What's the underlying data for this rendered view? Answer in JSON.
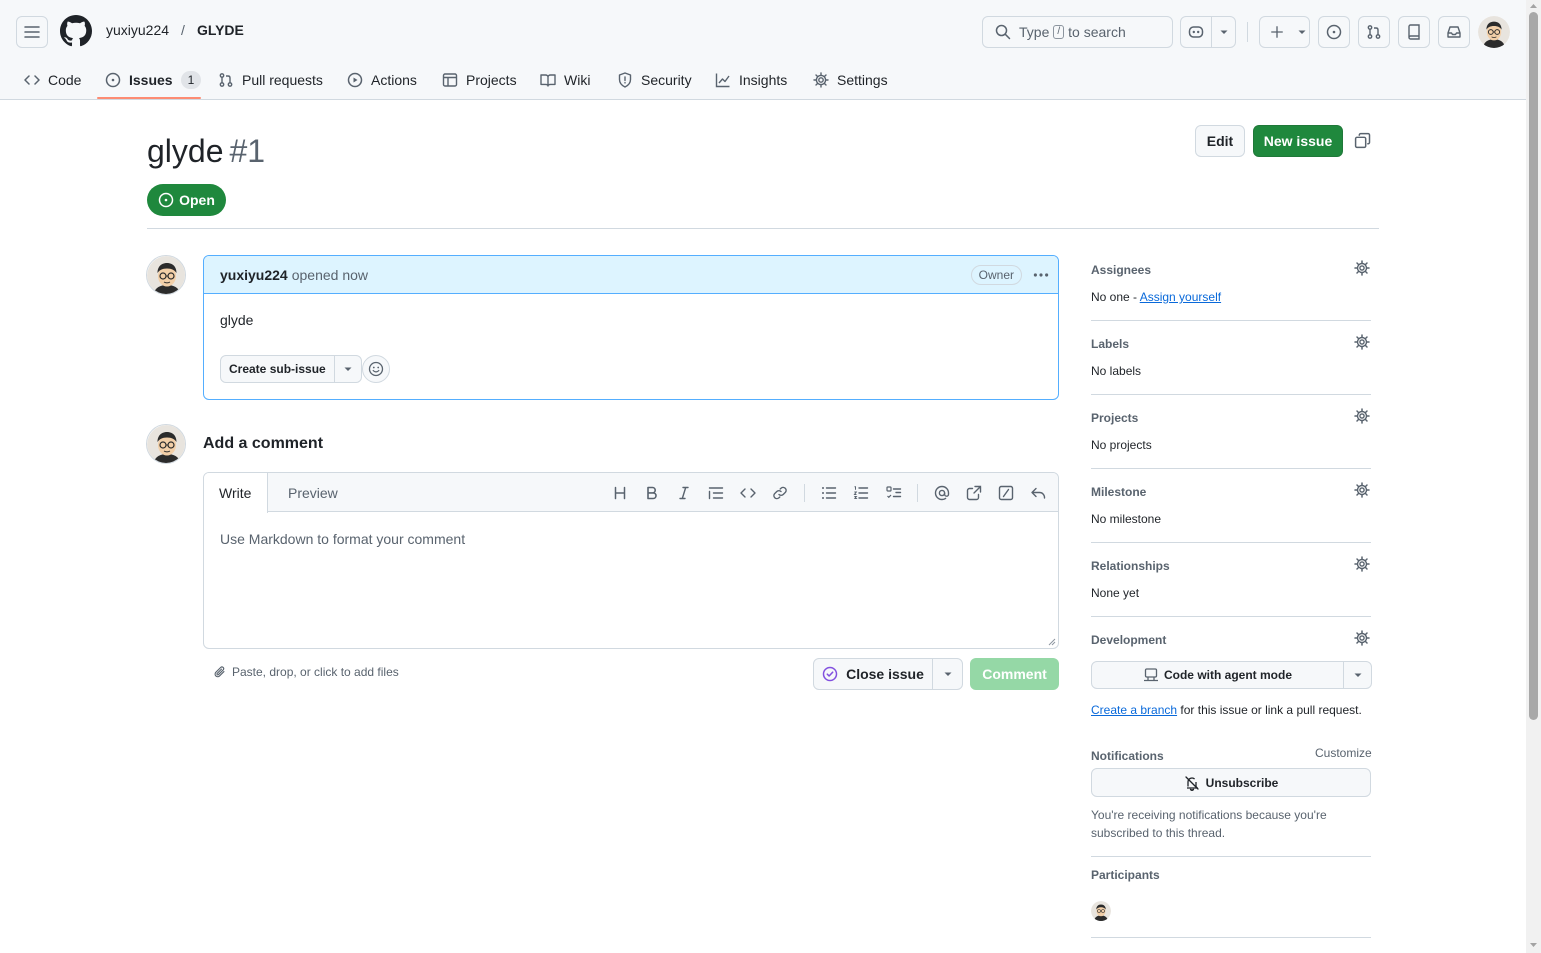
{
  "header": {
    "owner": "yuxiyu224",
    "separator": "/",
    "repo": "GLYDE",
    "search": {
      "prefix": "Type",
      "key": "/",
      "suffix": "to search"
    }
  },
  "nav_tabs": [
    {
      "label": "Code",
      "icon": "code-icon"
    },
    {
      "label": "Issues",
      "icon": "issue-opened-icon",
      "counter": "1",
      "selected": true
    },
    {
      "label": "Pull requests",
      "icon": "git-pull-request-icon"
    },
    {
      "label": "Actions",
      "icon": "play-icon"
    },
    {
      "label": "Projects",
      "icon": "table-icon"
    },
    {
      "label": "Wiki",
      "icon": "book-icon"
    },
    {
      "label": "Security",
      "icon": "shield-icon"
    },
    {
      "label": "Insights",
      "icon": "graph-icon"
    },
    {
      "label": "Settings",
      "icon": "gear-icon"
    }
  ],
  "issue": {
    "title": "glyde",
    "number": "#1",
    "state": "Open",
    "edit_label": "Edit",
    "new_issue_label": "New issue"
  },
  "comment": {
    "author": "yuxiyu224",
    "action": "opened now",
    "role_badge": "Owner",
    "body": "glyde",
    "create_sub_issue_label": "Create sub-issue"
  },
  "composer": {
    "heading": "Add a comment",
    "tab_write": "Write",
    "tab_preview": "Preview",
    "placeholder": "Use Markdown to format your comment",
    "files_hint": "Paste, drop, or click to add files",
    "close_issue_label": "Close issue",
    "comment_label": "Comment"
  },
  "sidebar": {
    "assignees": {
      "title": "Assignees",
      "value_prefix": "No one - ",
      "link": "Assign yourself"
    },
    "labels": {
      "title": "Labels",
      "value": "No labels"
    },
    "projects": {
      "title": "Projects",
      "value": "No projects"
    },
    "milestone": {
      "title": "Milestone",
      "value": "No milestone"
    },
    "relationships": {
      "title": "Relationships",
      "value": "None yet"
    },
    "development": {
      "title": "Development",
      "agent_button": "Code with agent mode",
      "branch_link": "Create a branch",
      "branch_suffix": " for this issue or link a pull request."
    },
    "notifications": {
      "title": "Notifications",
      "customize": "Customize",
      "unsubscribe": "Unsubscribe",
      "reason": "You're receiving notifications because you're subscribed to this thread."
    },
    "participants": {
      "title": "Participants"
    }
  },
  "colors": {
    "accent_green": "#1f883d",
    "link_blue": "#0969da",
    "tab_underline": "#fd8c73",
    "comment_header_bg": "#ddf4ff"
  }
}
